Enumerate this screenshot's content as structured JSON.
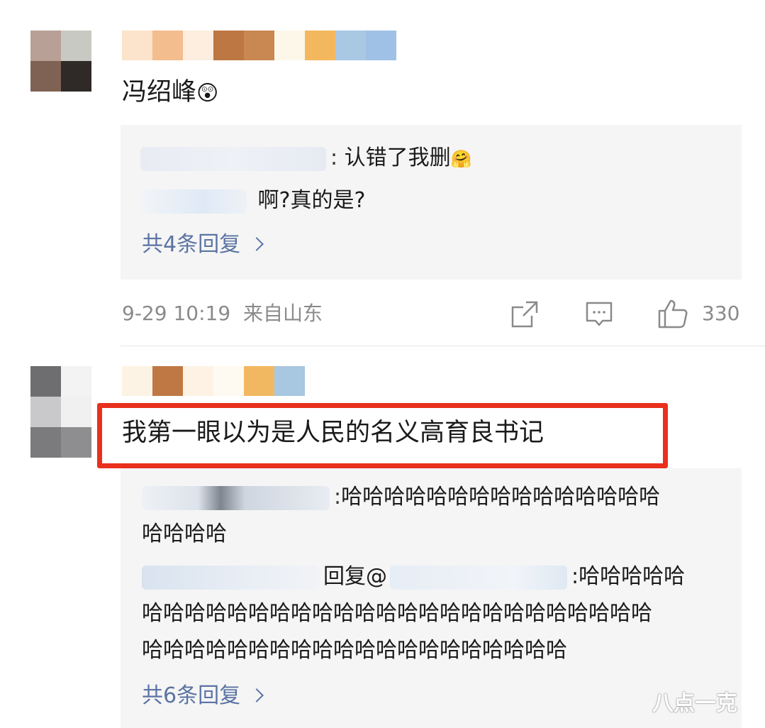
{
  "comment1": {
    "text": "冯绍峰",
    "reactions_emoji": "😲",
    "replies": [
      {
        "author_visible": ":",
        "text": "认错了我删",
        "emoji": "🤗"
      },
      {
        "author_visible": "",
        "text": "啊?真的是?"
      }
    ],
    "more_replies": "共4条回复",
    "timestamp": "9-29 10:19",
    "location": "来自山东",
    "like_count": "330"
  },
  "comment2": {
    "text": "我第一眼以为是人民的名义高育良书记",
    "replies": [
      {
        "author_visible": ":",
        "text_line1": "哈哈哈哈哈哈哈哈哈哈哈哈哈哈哈",
        "text_line2": "哈哈哈哈"
      },
      {
        "reply_label": "回复@",
        "text_line1": ":哈哈哈哈哈",
        "text_line2": "哈哈哈哈哈哈哈哈哈哈哈哈哈哈哈哈哈哈哈哈哈哈哈哈",
        "text_line3": "哈哈哈哈哈哈哈哈哈哈哈哈哈哈哈哈哈哈哈哈"
      }
    ],
    "more_replies": "共6条回复"
  },
  "watermark": "八点一克",
  "icons": [
    "share-icon",
    "comment-icon",
    "like-icon",
    "chevron-right-icon"
  ],
  "colors": {
    "link": "#5b74a3",
    "highlight": "#e8301c",
    "reply_bg": "#f5f5f5"
  }
}
